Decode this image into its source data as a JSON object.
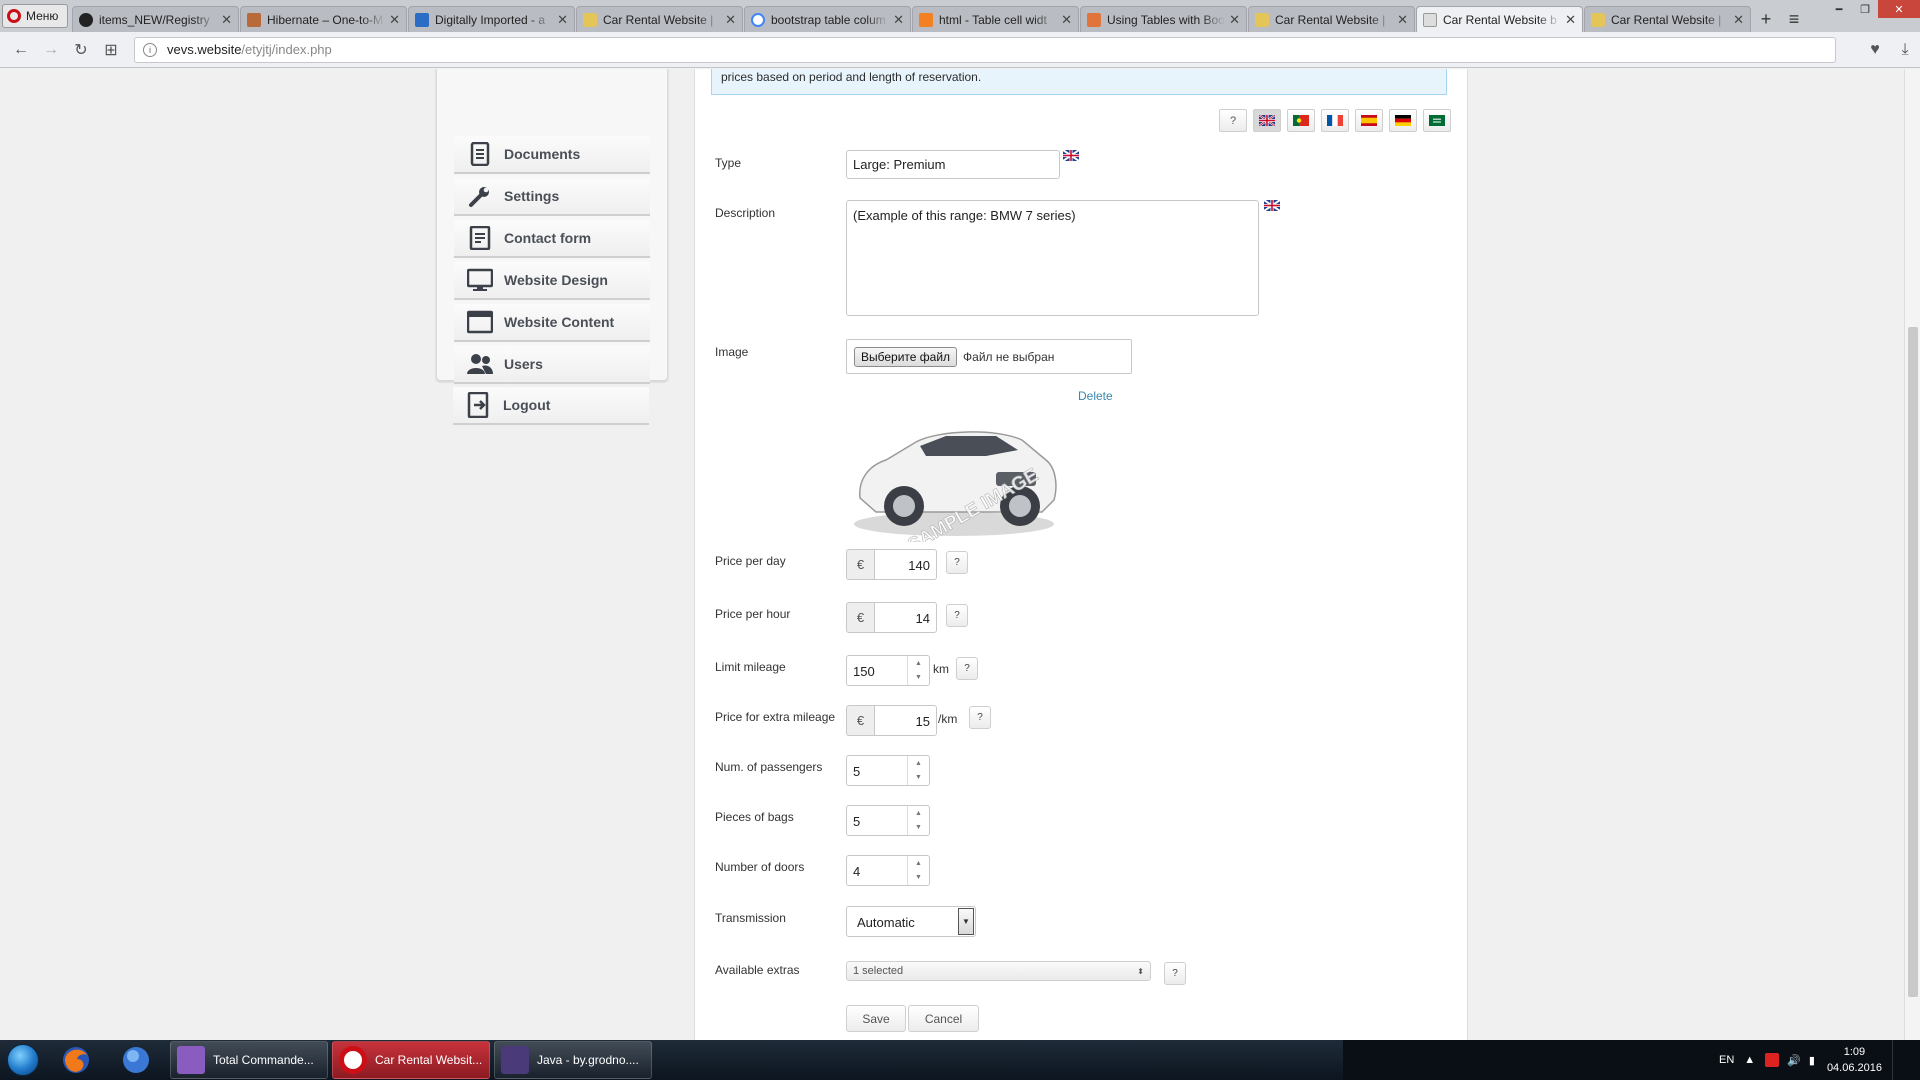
{
  "browser": {
    "menu_label": "Меню",
    "tabs": [
      {
        "title": "items_NEW/Registry",
        "favicon": "github-icon",
        "active": false
      },
      {
        "title": "Hibernate – One-to-M",
        "favicon": "hibernate-icon",
        "active": false
      },
      {
        "title": "Digitally Imported - a",
        "favicon": "di-icon",
        "active": false
      },
      {
        "title": "Car Rental Website | ",
        "favicon": "folder-icon",
        "active": false
      },
      {
        "title": "bootstrap table colum",
        "favicon": "google-icon",
        "active": false
      },
      {
        "title": "html - Table cell widt",
        "favicon": "stackoverflow-icon",
        "active": false
      },
      {
        "title": "Using Tables with Boo",
        "favicon": "fire-icon",
        "active": false
      },
      {
        "title": "Car Rental Website | ",
        "favicon": "folder-icon",
        "active": false
      },
      {
        "title": "Car Rental Website b",
        "favicon": "page-icon",
        "active": true
      },
      {
        "title": "Car Rental Website | ",
        "favicon": "folder-icon",
        "active": false
      }
    ],
    "url_domain": "vevs.website",
    "url_path": "/etyjtj/index.php"
  },
  "sidebar": {
    "items": [
      {
        "label": "Documents",
        "icon": "documents-icon"
      },
      {
        "label": "Settings",
        "icon": "wrench-icon"
      },
      {
        "label": "Contact form",
        "icon": "contact-form-icon"
      },
      {
        "label": "Website Design",
        "icon": "monitor-icon"
      },
      {
        "label": "Website Content",
        "icon": "window-icon"
      },
      {
        "label": "Users",
        "icon": "users-icon"
      },
      {
        "label": "Logout",
        "icon": "logout-icon"
      }
    ]
  },
  "main": {
    "notice_text": "prices based on period and length of reservation.",
    "lang_help": "?",
    "languages": [
      "English",
      "Portuguese",
      "French",
      "Spanish",
      "German",
      "Arabic"
    ],
    "form": {
      "type_label": "Type",
      "type_value": "Large: Premium",
      "description_label": "Description",
      "description_value": "(Example of this range: BMW 7 series)",
      "image_label": "Image",
      "file_button": "Выберите файл",
      "file_status": "Файл не выбран",
      "delete_link": "Delete",
      "image_watermark": "SAMPLE IMAGE",
      "price_day_label": "Price per day",
      "price_day_value": "140",
      "price_hour_label": "Price per hour",
      "price_hour_value": "14",
      "limit_mileage_label": "Limit mileage",
      "limit_mileage_value": "150",
      "limit_mileage_unit": "km",
      "extra_mileage_label": "Price for extra mileage",
      "extra_mileage_value": "15",
      "extra_mileage_unit": "/km",
      "passengers_label": "Num. of passengers",
      "passengers_value": "5",
      "bags_label": "Pieces of bags",
      "bags_value": "5",
      "doors_label": "Number of doors",
      "doors_value": "4",
      "transmission_label": "Transmission",
      "transmission_value": "Automatic",
      "extras_label": "Available extras",
      "extras_value": "1 selected",
      "currency": "€",
      "help": "?",
      "save_label": "Save",
      "cancel_label": "Cancel"
    }
  },
  "taskbar": {
    "items": [
      {
        "label": "Total Commande...",
        "active": false
      },
      {
        "label": "Car Rental Websit...",
        "active": true
      },
      {
        "label": "Java - by.grodno....",
        "active": false
      }
    ],
    "lang": "EN",
    "time": "1:09",
    "date": "04.06.2016"
  },
  "colors": {
    "accent_link": "#3a87ad",
    "notice_bg": "#e8f4fb",
    "taskbar_active": "#c7323b"
  }
}
